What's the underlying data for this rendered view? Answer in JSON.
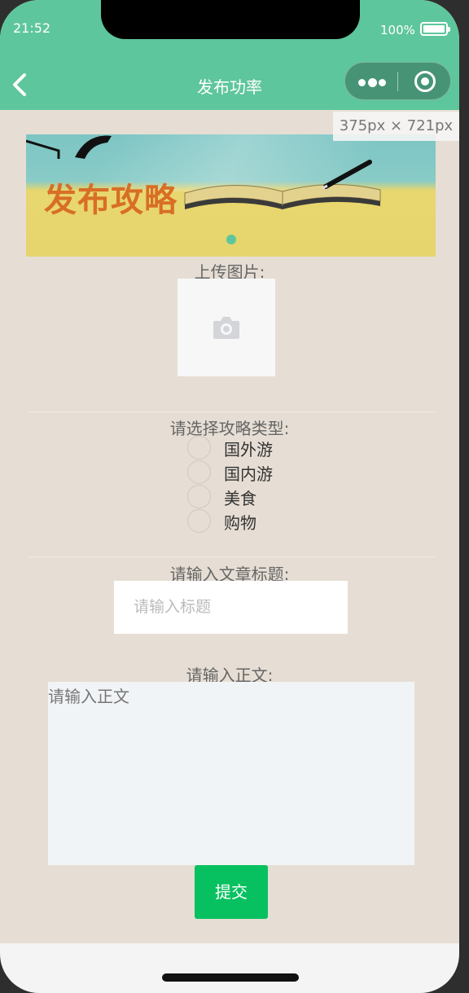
{
  "status_bar": {
    "time": "21:52",
    "battery": "100%"
  },
  "nav": {
    "title": "发布功率",
    "back_icon": "chevron-left-icon",
    "more_icon": "more-dots-icon",
    "close_icon": "target-close-icon"
  },
  "devtools": {
    "dimensions": "375px × 721px"
  },
  "banner": {
    "title": "发布攻略",
    "indicator_count": 1
  },
  "upload": {
    "label": "上传图片:",
    "icon": "camera-icon"
  },
  "type_select": {
    "label": "请选择攻略类型:",
    "options": [
      "国外游",
      "国内游",
      "美食",
      "购物"
    ]
  },
  "title_field": {
    "label": "请输入文章标题:",
    "placeholder": "请输入标题"
  },
  "body_field": {
    "label": "请输入正文:",
    "placeholder": "请输入正文"
  },
  "submit": {
    "label": "提交"
  },
  "colors": {
    "nav_bg": "#5ec69c",
    "page_bg": "#e6ded4",
    "submit_bg": "#07c160",
    "banner_title": "#d86e26"
  }
}
